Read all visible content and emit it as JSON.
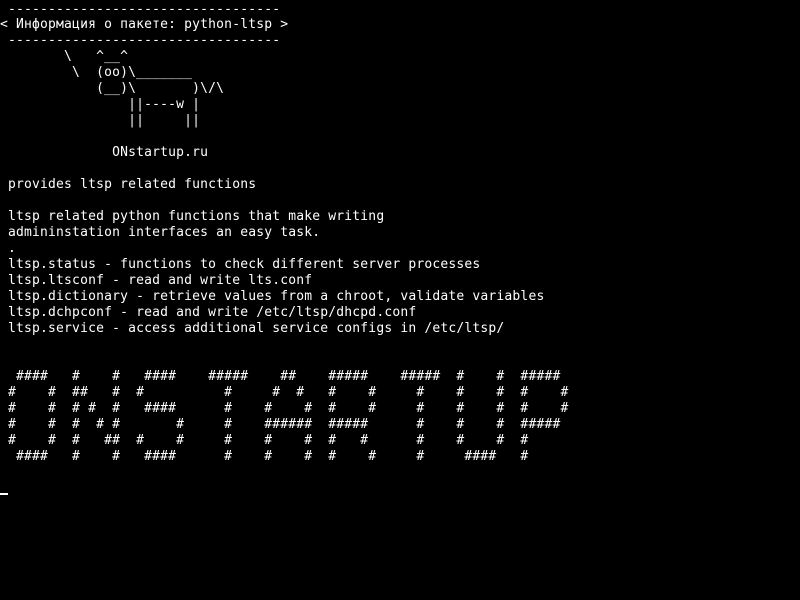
{
  "terminal": {
    "bg_color": "#000000",
    "fg_color": "#ffffff",
    "bubble_top": " ----------------------------------",
    "bubble_text": "< Информация о пакете: python-ltsp >",
    "bubble_bottom": " ----------------------------------",
    "cow_1": "        \\   ^__^",
    "cow_2": "         \\  (oo)\\_______",
    "cow_3": "            (__)\\       )\\/\\",
    "cow_4": "                ||----w |",
    "cow_5": "                ||     ||",
    "site": "              ONstartup.ru",
    "summary": " provides ltsp related functions",
    "desc_1": " ltsp related python functions that make writing",
    "desc_2": " admininstation interfaces an easy task.",
    "desc_3": " .",
    "desc_4": " ltsp.status - functions to check different server processes",
    "desc_5": " ltsp.ltsconf - read and write lts.conf",
    "desc_6": " ltsp.dictionary - retrieve values from a chroot, validate variables",
    "desc_7": " ltsp.dchpconf - read and write /etc/ltsp/dhcpd.conf",
    "desc_8": " ltsp.service - access additional service configs in /etc/ltsp/",
    "banner_1": "  ####   #    #   ####    #####    ##    #####    #####  #    #  #####",
    "banner_2": " #    #  ##   #  #          #     #  #   #    #     #    #    #  #    #",
    "banner_3": " #    #  # #  #   ####      #    #    #  #    #     #    #    #  #    #",
    "banner_4": " #    #  #  # #       #     #    ######  #####      #    #    #  #####",
    "banner_5": " #    #  #   ##  #    #     #    #    #  #   #      #    #    #  #",
    "banner_6": "  ####   #    #   ####      #    #    #  #    #     #     ####   #"
  }
}
